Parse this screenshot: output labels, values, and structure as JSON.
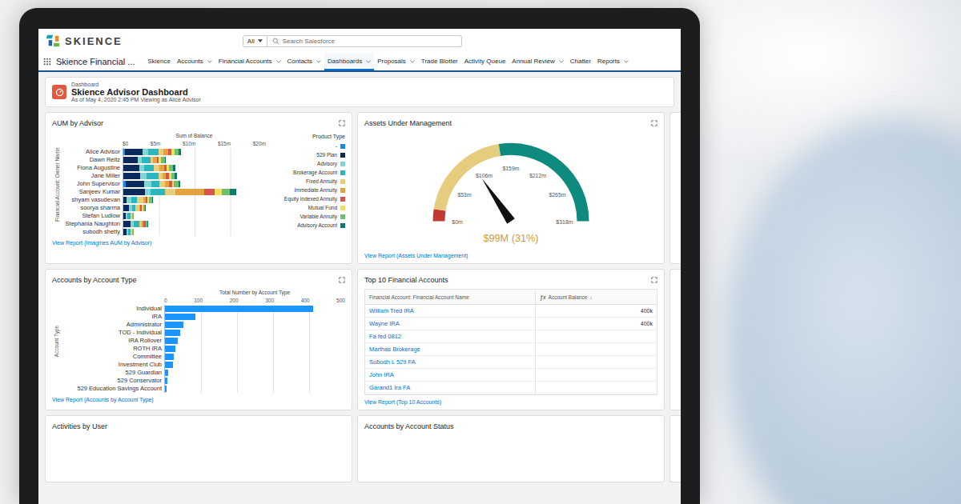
{
  "app": {
    "logo": "SKIENCE",
    "name": "Skience Financial ...",
    "search_scope": "All",
    "search_placeholder": "Search Salesforce"
  },
  "nav": [
    {
      "label": "Skience",
      "menu": false,
      "selected": false
    },
    {
      "label": "Accounts",
      "menu": true,
      "selected": false
    },
    {
      "label": "Financial Accounts",
      "menu": true,
      "selected": false
    },
    {
      "label": "Contacts",
      "menu": true,
      "selected": false
    },
    {
      "label": "Dashboards",
      "menu": true,
      "selected": true
    },
    {
      "label": "Proposals",
      "menu": true,
      "selected": false
    },
    {
      "label": "Trade Blotter",
      "menu": false,
      "selected": false
    },
    {
      "label": "Activity Queue",
      "menu": false,
      "selected": false
    },
    {
      "label": "Annual Review",
      "menu": true,
      "selected": false
    },
    {
      "label": "Chatter",
      "menu": false,
      "selected": false
    },
    {
      "label": "Reports",
      "menu": true,
      "selected": false
    }
  ],
  "header": {
    "kicker": "Dashboard",
    "title": "Skience Advisor Dashboard",
    "subtitle": "As of May 4, 2020 2:45 PM Viewing as Alice Advisor"
  },
  "aum_by_advisor": {
    "title": "AUM by Advisor",
    "axis_title": "Sum of Balance",
    "ticks": [
      "$0",
      "$5m",
      "$10m",
      "$15m",
      "$20m"
    ],
    "y_title": "Financial Account: Owner Name",
    "legend_title": "Product Type",
    "categories": [
      "Alice Advisor",
      "Dawn Reitz",
      "Fiona Augustine",
      "Jane Miller",
      "John Supervisor",
      "Sanjeev Kumar",
      "shyam vasudevan",
      "soorya sharma",
      "Stefan Ludlow",
      "Stephania Naughton",
      "subodh shetty"
    ],
    "series": [
      {
        "name": "-",
        "color": "#1589ee",
        "values": [
          0.2,
          0,
          0,
          0,
          0.3,
          0,
          0,
          0,
          0,
          0,
          0
        ]
      },
      {
        "name": "529 Plan",
        "color": "#0b2a5b",
        "values": [
          2.5,
          2.0,
          2.2,
          2.4,
          2.6,
          3.0,
          0.5,
          0.8,
          0.3,
          1.0,
          0.4
        ]
      },
      {
        "name": "Advisory",
        "color": "#7fd6d2",
        "values": [
          0.8,
          0.6,
          0.7,
          0.9,
          1.0,
          0.8,
          0.6,
          0.4,
          0.3,
          0.5,
          0.3
        ]
      },
      {
        "name": "Brokerage Account",
        "color": "#2cb6c0",
        "values": [
          1.5,
          1.2,
          1.4,
          1.6,
          1.2,
          2.0,
          0.8,
          0.5,
          0.4,
          0.7,
          0.3
        ]
      },
      {
        "name": "Fixed Annuity",
        "color": "#e8cd7a",
        "values": [
          0.6,
          0.4,
          0.8,
          0.6,
          0.7,
          1.5,
          0.9,
          0.5,
          0.2,
          0.4,
          0.2
        ]
      },
      {
        "name": "Immediate Annuity",
        "color": "#e6a23c",
        "values": [
          0.7,
          0.5,
          0.6,
          0.5,
          0.6,
          4.0,
          0.3,
          0.2,
          0.1,
          0.2,
          0.1
        ]
      },
      {
        "name": "Equity Indexed Annuity",
        "color": "#d9534f",
        "values": [
          0.5,
          0.3,
          0.4,
          0.4,
          0.5,
          1.5,
          0.3,
          0.2,
          0,
          0.3,
          0
        ]
      },
      {
        "name": "Mutual Fund",
        "color": "#f2df5c",
        "values": [
          0.4,
          0.3,
          0.3,
          0.3,
          0.2,
          1.0,
          0.2,
          0.2,
          0,
          0.1,
          0
        ]
      },
      {
        "name": "Variable Annuity",
        "color": "#6fbf73",
        "values": [
          0.6,
          0.5,
          0.6,
          0.5,
          0.7,
          1.2,
          0.4,
          0.3,
          0.1,
          0.2,
          0.1
        ]
      },
      {
        "name": "Advisory Account",
        "color": "#0f7a6b",
        "values": [
          0.3,
          0.2,
          0.3,
          0.3,
          0.2,
          0.8,
          0.2,
          0.1,
          0,
          0.1,
          0
        ]
      }
    ],
    "link": "View Report (Imagines AUM by Advisor)"
  },
  "gauge": {
    "title": "Assets Under Management",
    "ticks": [
      "$0m",
      "$53m",
      "$106m",
      "$159m",
      "$212m",
      "$265m",
      "$318m"
    ],
    "level": 0.31,
    "value": "$99M (31%)",
    "segments": [
      {
        "to": 0.05,
        "color": "#c23934"
      },
      {
        "to": 0.45,
        "color": "#e6cd7e"
      },
      {
        "to": 1,
        "color": "#0f8a7e"
      }
    ],
    "link": "View Report (Assets Under Management)"
  },
  "account_types": {
    "title": "Accounts by Account Type",
    "axis_title": "Total Number by Account Type",
    "ticks": [
      "0",
      "100",
      "200",
      "300",
      "400",
      "500"
    ],
    "y_title": "Account Type",
    "categories": [
      "Individual",
      "IRA",
      "Administrator",
      "TOD - Individual",
      "IRA Rollover",
      "ROTH IRA",
      "Committee",
      "Investment Club",
      "529 Guardian",
      "529 Conservator",
      "529 Education Savings Account"
    ],
    "values": [
      410,
      85,
      50,
      42,
      35,
      28,
      24,
      22,
      8,
      6,
      4
    ],
    "link": "View Report (Accounts by Account Type)"
  },
  "top_accounts": {
    "title": "Top 10 Financial Accounts",
    "columns": [
      {
        "label": "Financial Account: Financial Account Name",
        "icon": "",
        "sort": ""
      },
      {
        "label": "Account Balance",
        "icon": "ƒx",
        "sort": "↓"
      }
    ],
    "rows": [
      {
        "name": "William Tred IRA",
        "balance": "400k"
      },
      {
        "name": "Wayne IRA",
        "balance": "400k"
      },
      {
        "name": "Fa fed 0812",
        "balance": ""
      },
      {
        "name": "Marthas Brokerage",
        "balance": ""
      },
      {
        "name": "Subodh L 529 FA",
        "balance": ""
      },
      {
        "name": "John IRA",
        "balance": ""
      },
      {
        "name": "Garand1 Ira FA",
        "balance": ""
      }
    ],
    "link": "View Report (Top 10 Accounts)"
  },
  "more_cards": [
    {
      "title": "Activities by User"
    },
    {
      "title": "Accounts by Account Status"
    }
  ]
}
